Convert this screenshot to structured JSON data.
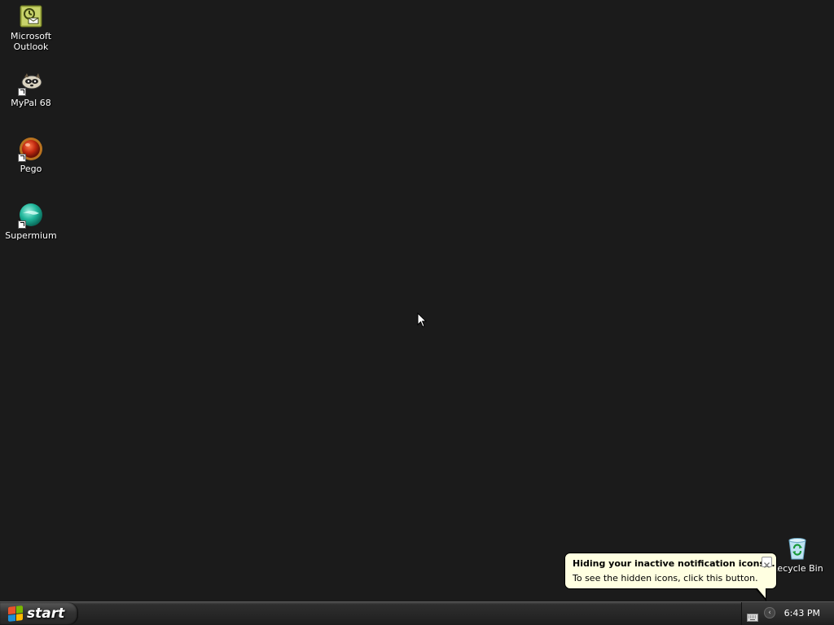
{
  "desktop": {
    "icons": [
      {
        "label_line1": "Microsoft",
        "label_line2": "Outlook",
        "icon": "outlook-icon"
      },
      {
        "label": "MyPal 68",
        "icon": "mypal-icon"
      },
      {
        "label": "Pego",
        "icon": "pego-icon"
      },
      {
        "label": "Supermium",
        "icon": "supermium-icon"
      }
    ],
    "recycle_bin": {
      "label": "Recycle Bin",
      "icon": "recycle-bin-icon"
    }
  },
  "taskbar": {
    "start_label": "start",
    "start_logo_colors": [
      "#e8532a",
      "#7ab800",
      "#1e8fd6",
      "#ffb900"
    ],
    "clock": "6:43 PM"
  },
  "balloon": {
    "title": "Hiding your inactive notification icons...",
    "text": "To see the hidden icons, click this button."
  },
  "colors": {
    "desktop_bg": "#1b1b1b",
    "balloon_bg": "#ffffe1"
  }
}
